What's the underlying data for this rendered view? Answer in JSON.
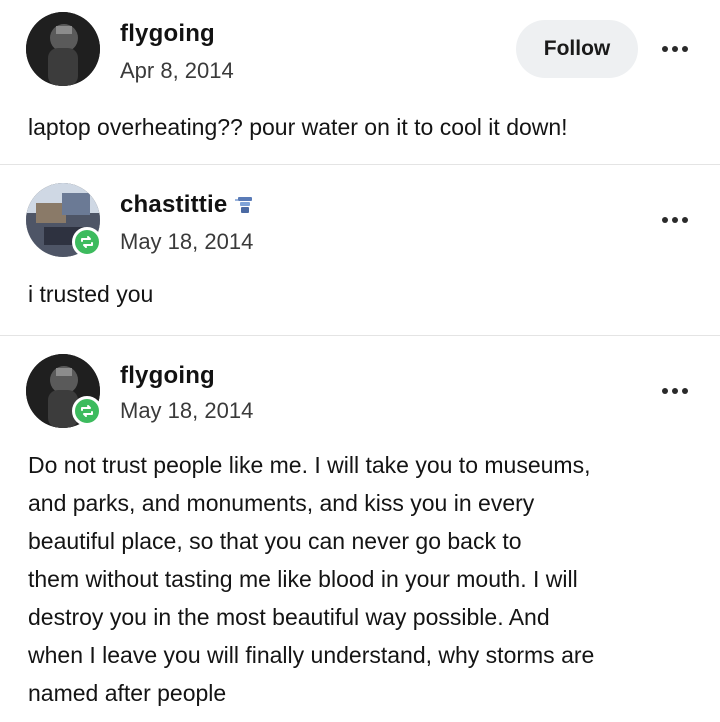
{
  "posts": [
    {
      "username": "flygoing",
      "date": "Apr 8, 2014",
      "follow_label": "Follow",
      "text": "laptop overheating?? pour water on it to cool it down!"
    },
    {
      "username": "chastittie",
      "date": "May 18, 2014",
      "text": "i trusted you"
    },
    {
      "username": "flygoing",
      "date": "May 18, 2014",
      "lines": [
        "Do not trust people like me. I will take you to museums,",
        "and parks, and monuments, and kiss you in every",
        "beautiful place, so that you can never go back to",
        "them without tasting me like blood in your mouth. I will",
        "destroy you in the most beautiful way possible. And",
        "when I leave you will finally understand, why storms are",
        "named after people"
      ]
    }
  ],
  "icons": {
    "reblog": "reblog-icon",
    "menu": "more-options-icon",
    "flag": "badge-icon"
  },
  "colors": {
    "reblog_badge": "#3dbb5e",
    "follow_bg": "#eef0f2"
  }
}
